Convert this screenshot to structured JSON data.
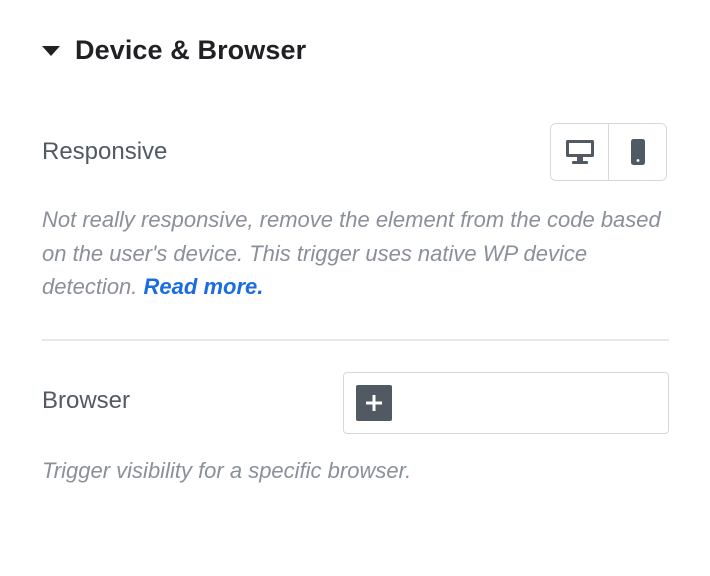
{
  "section": {
    "title": "Device & Browser",
    "caret_icon": "caret-down-icon"
  },
  "responsive": {
    "label": "Responsive",
    "devices": [
      {
        "name": "Desktop",
        "icon": "desktop-icon"
      },
      {
        "name": "Mobile",
        "icon": "mobile-icon"
      }
    ],
    "description": "Not really responsive, remove the element from the code based on the user's device. This trigger uses native WP device detection.",
    "read_more": "Read more."
  },
  "browser": {
    "label": "Browser",
    "add_icon": "plus-icon",
    "description": "Trigger visibility for a specific browser."
  },
  "colors": {
    "text_dark": "#1f2124",
    "label": "#515962",
    "muted": "#8a9099",
    "link": "#1a6ce0",
    "border": "#d5d8dc"
  }
}
